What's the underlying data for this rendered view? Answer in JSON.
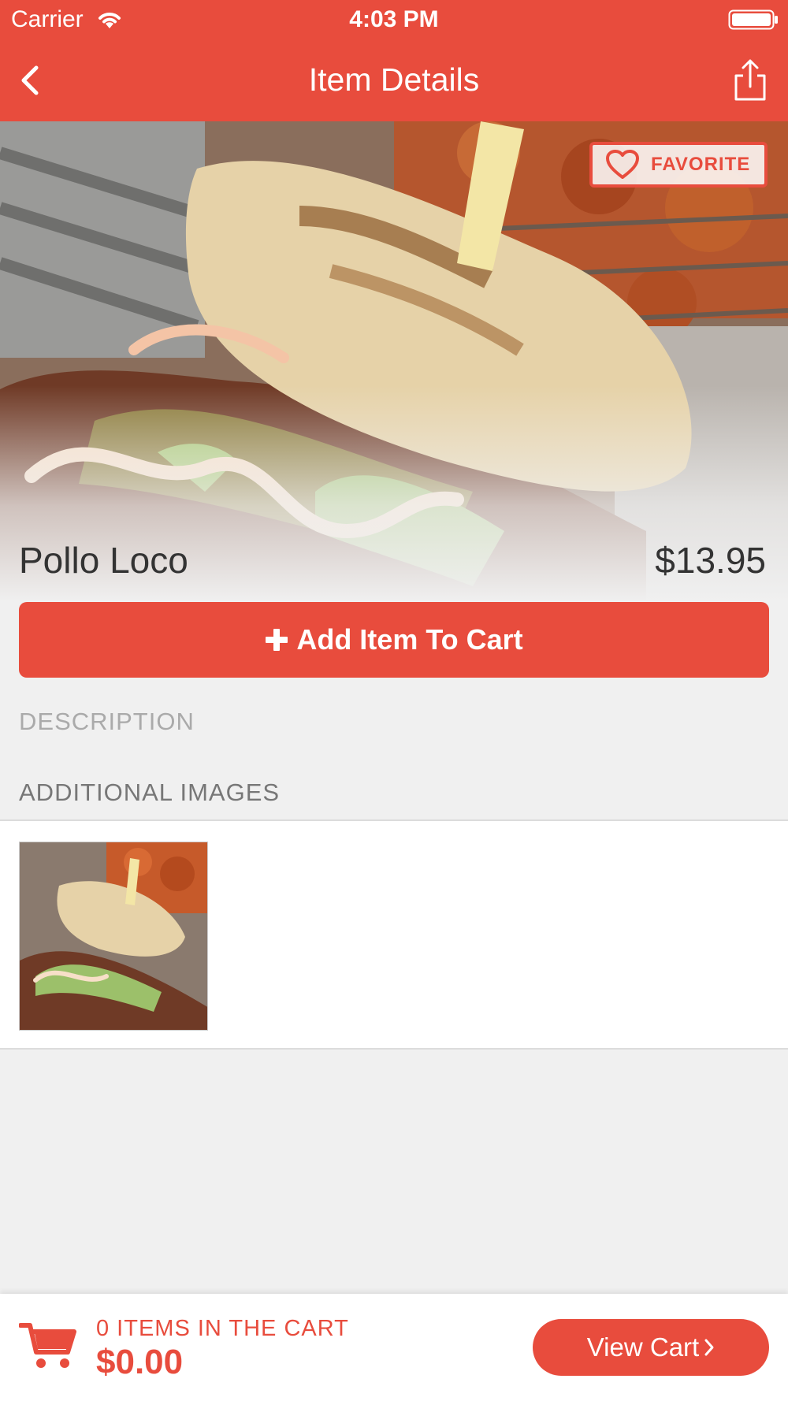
{
  "status_bar": {
    "carrier": "Carrier",
    "time": "4:03 PM"
  },
  "nav": {
    "title": "Item Details"
  },
  "favorite": {
    "label": "FAVORITE"
  },
  "item": {
    "name": "Pollo Loco",
    "price": "$13.95"
  },
  "actions": {
    "add_to_cart": "Add Item To Cart"
  },
  "sections": {
    "description": "DESCRIPTION",
    "additional_images": "ADDITIONAL IMAGES"
  },
  "cart": {
    "count_label": "0 ITEMS IN THE CART",
    "total": "$0.00",
    "view_cart": "View Cart"
  },
  "colors": {
    "accent": "#e84c3d",
    "background": "#f0f0f0"
  },
  "icons": [
    "wifi-icon",
    "battery-icon",
    "back-chevron-icon",
    "share-icon",
    "heart-icon",
    "plus-icon",
    "cart-icon",
    "chevron-right-icon"
  ]
}
